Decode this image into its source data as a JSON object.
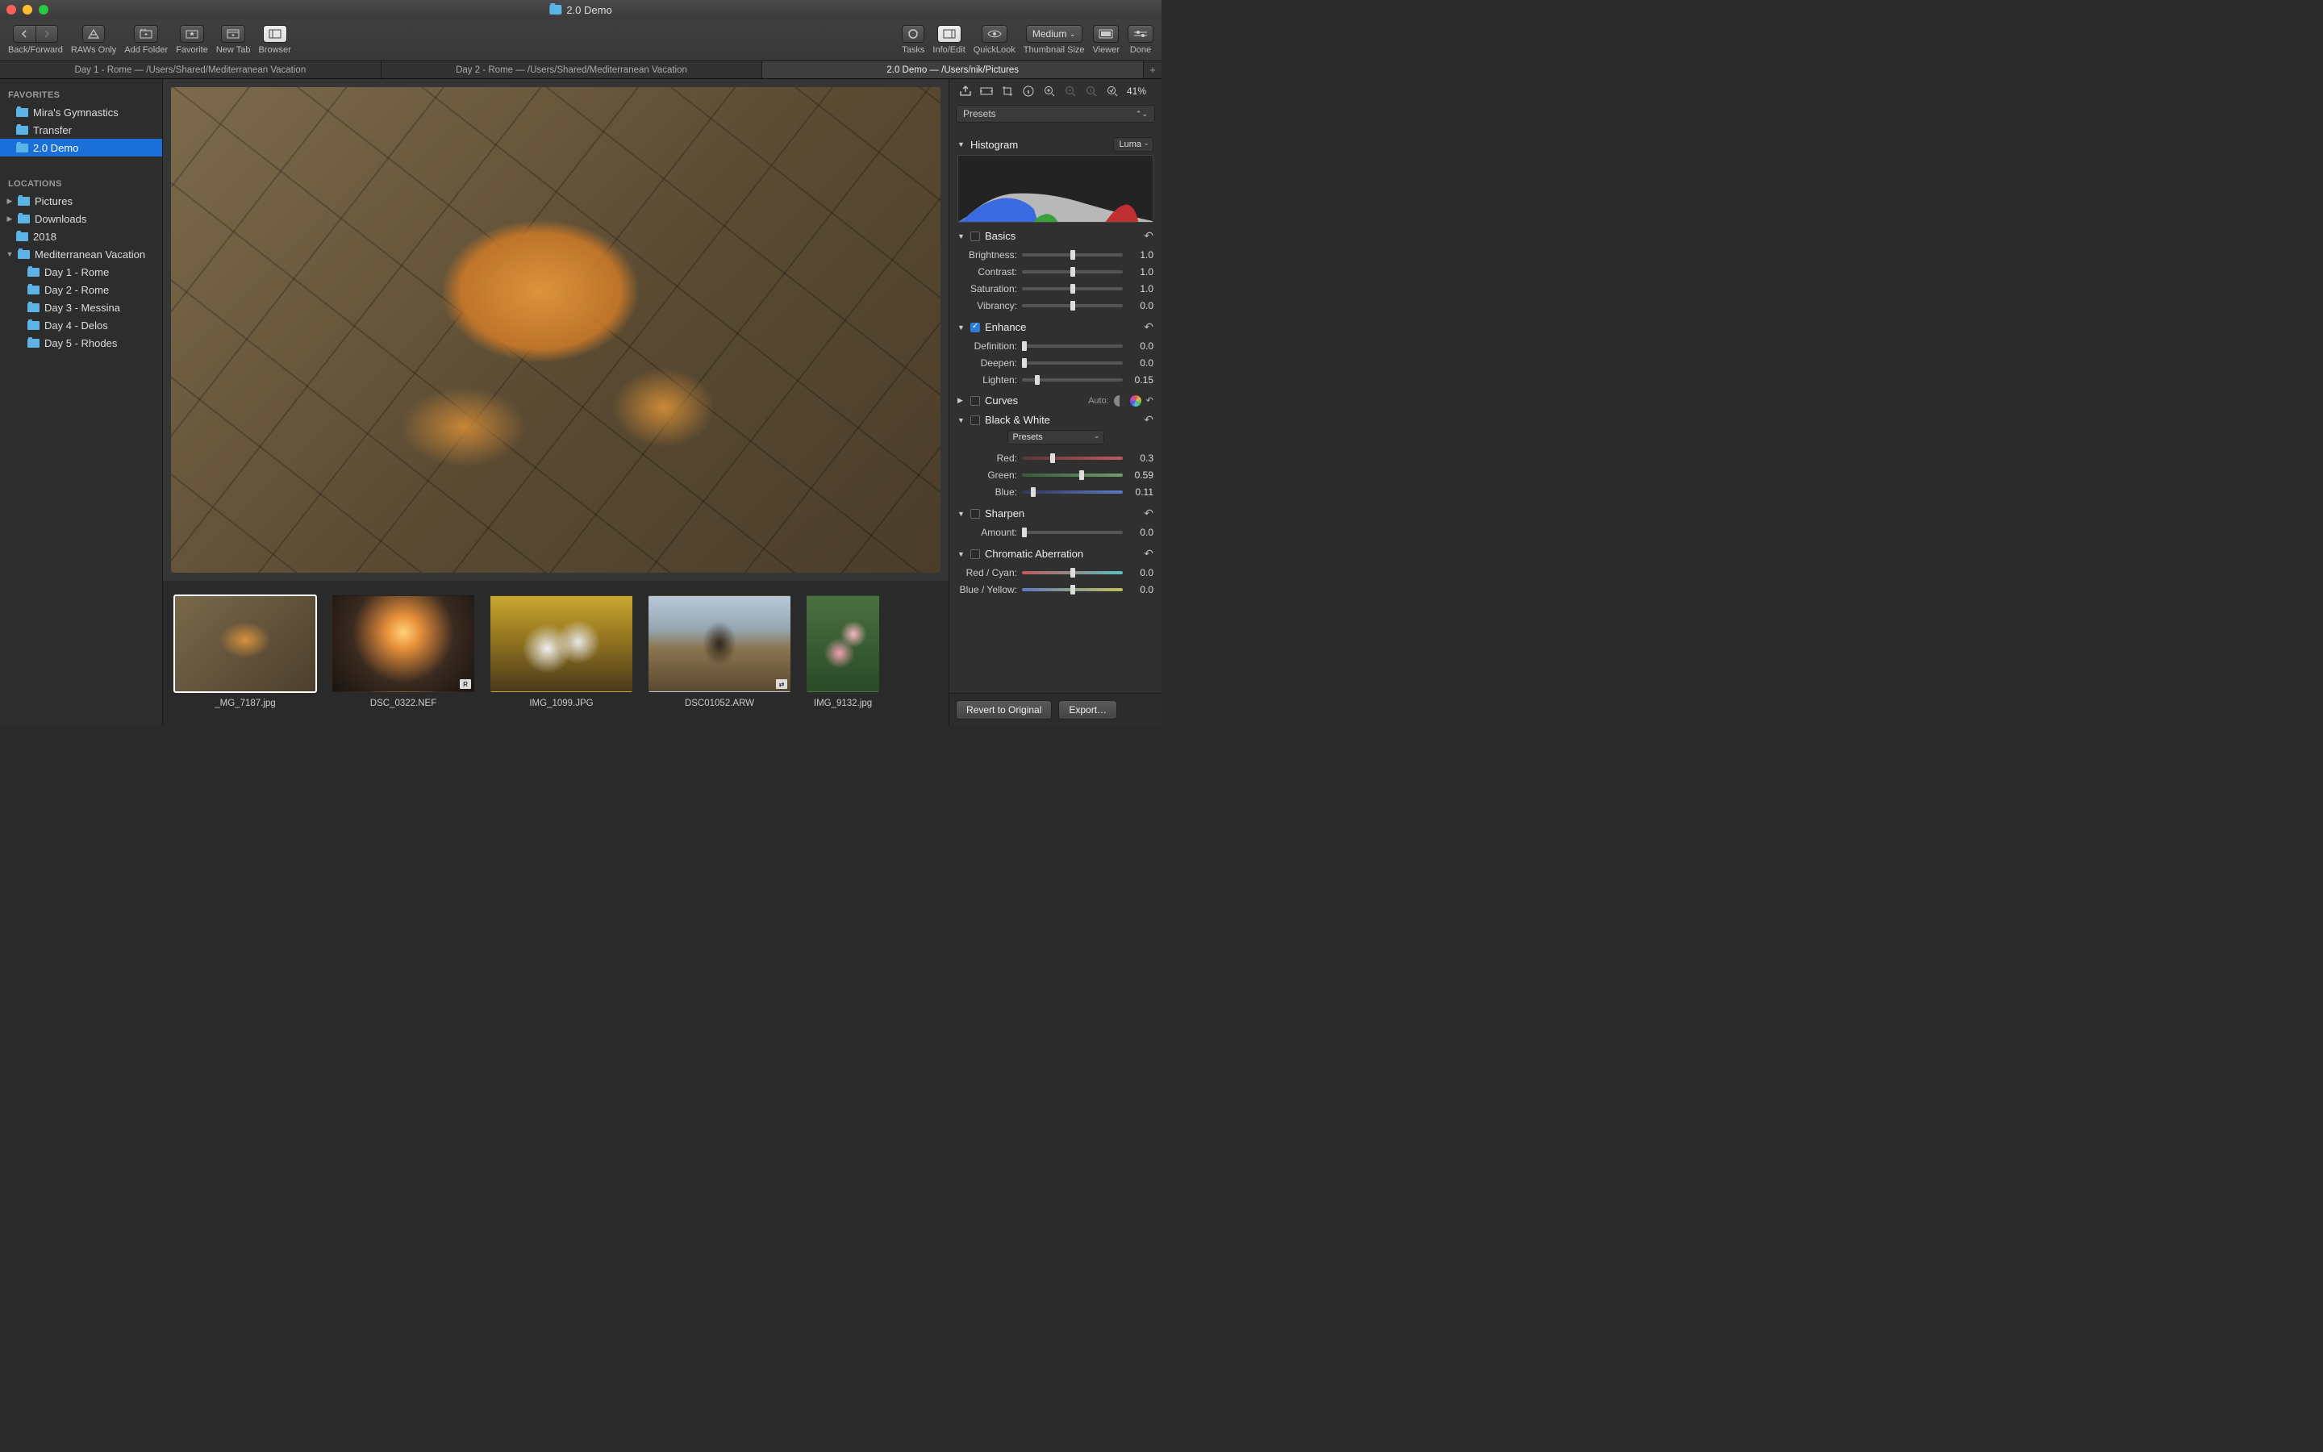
{
  "window": {
    "title": "2.0 Demo"
  },
  "toolbar": {
    "back_forward_label": "Back/Forward",
    "raws_only_label": "RAWs Only",
    "add_folder_label": "Add Folder",
    "favorite_label": "Favorite",
    "new_tab_label": "New Tab",
    "browser_label": "Browser",
    "tasks_label": "Tasks",
    "info_edit_label": "Info/Edit",
    "quicklook_label": "QuickLook",
    "thumbnail_size_label": "Thumbnail Size",
    "thumbnail_size_value": "Medium",
    "viewer_label": "Viewer",
    "done_label": "Done"
  },
  "tabs": [
    {
      "title": "Day 1 - Rome  —  /Users/Shared/Mediterranean Vacation",
      "active": false
    },
    {
      "title": "Day 2 - Rome  —  /Users/Shared/Mediterranean Vacation",
      "active": false
    },
    {
      "title": "2.0 Demo  —  /Users/nik/Pictures",
      "active": true
    }
  ],
  "sidebar": {
    "favorites_label": "FAVORITES",
    "favorites": [
      {
        "label": "Mira's Gymnastics"
      },
      {
        "label": "Transfer"
      },
      {
        "label": "2.0 Demo",
        "selected": true
      }
    ],
    "locations_label": "LOCATIONS",
    "locations": [
      {
        "label": "Pictures",
        "disc": "▶"
      },
      {
        "label": "Downloads",
        "disc": "▶"
      },
      {
        "label": "2018",
        "disc": ""
      },
      {
        "label": "Mediterranean Vacation",
        "disc": "▼",
        "children": [
          {
            "label": "Day 1 - Rome"
          },
          {
            "label": "Day 2 - Rome"
          },
          {
            "label": "Day 3 - Messina"
          },
          {
            "label": "Day 4 - Delos"
          },
          {
            "label": "Day 5 - Rhodes"
          }
        ]
      }
    ]
  },
  "filmstrip": [
    {
      "filename": "_MG_7187.jpg",
      "selected": true,
      "badge": ""
    },
    {
      "filename": "DSC_0322.NEF",
      "badge": "R"
    },
    {
      "filename": "IMG_1099.JPG",
      "badge": ""
    },
    {
      "filename": "DSC01052.ARW",
      "badge": "⇄"
    },
    {
      "filename": "IMG_9132.jpg",
      "badge": ""
    }
  ],
  "inspector": {
    "zoom_pct": "41%",
    "presets_label": "Presets",
    "histogram": {
      "label": "Histogram",
      "mode": "Luma"
    },
    "basics": {
      "label": "Basics",
      "brightness_label": "Brightness:",
      "brightness_value": "1.0",
      "contrast_label": "Contrast:",
      "contrast_value": "1.0",
      "saturation_label": "Saturation:",
      "saturation_value": "1.0",
      "vibrancy_label": "Vibrancy:",
      "vibrancy_value": "0.0"
    },
    "enhance": {
      "label": "Enhance",
      "definition_label": "Definition:",
      "definition_value": "0.0",
      "deepen_label": "Deepen:",
      "deepen_value": "0.0",
      "lighten_label": "Lighten:",
      "lighten_value": "0.15"
    },
    "curves": {
      "label": "Curves",
      "auto_label": "Auto:"
    },
    "bw": {
      "label": "Black & White",
      "presets_label": "Presets",
      "red_label": "Red:",
      "red_value": "0.3",
      "green_label": "Green:",
      "green_value": "0.59",
      "blue_label": "Blue:",
      "blue_value": "0.11"
    },
    "sharpen": {
      "label": "Sharpen",
      "amount_label": "Amount:",
      "amount_value": "0.0"
    },
    "ca": {
      "label": "Chromatic Aberration",
      "rc_label": "Red / Cyan:",
      "rc_value": "0.0",
      "by_label": "Blue / Yellow:",
      "by_value": "0.0"
    },
    "revert_label": "Revert to Original",
    "export_label": "Export…"
  }
}
